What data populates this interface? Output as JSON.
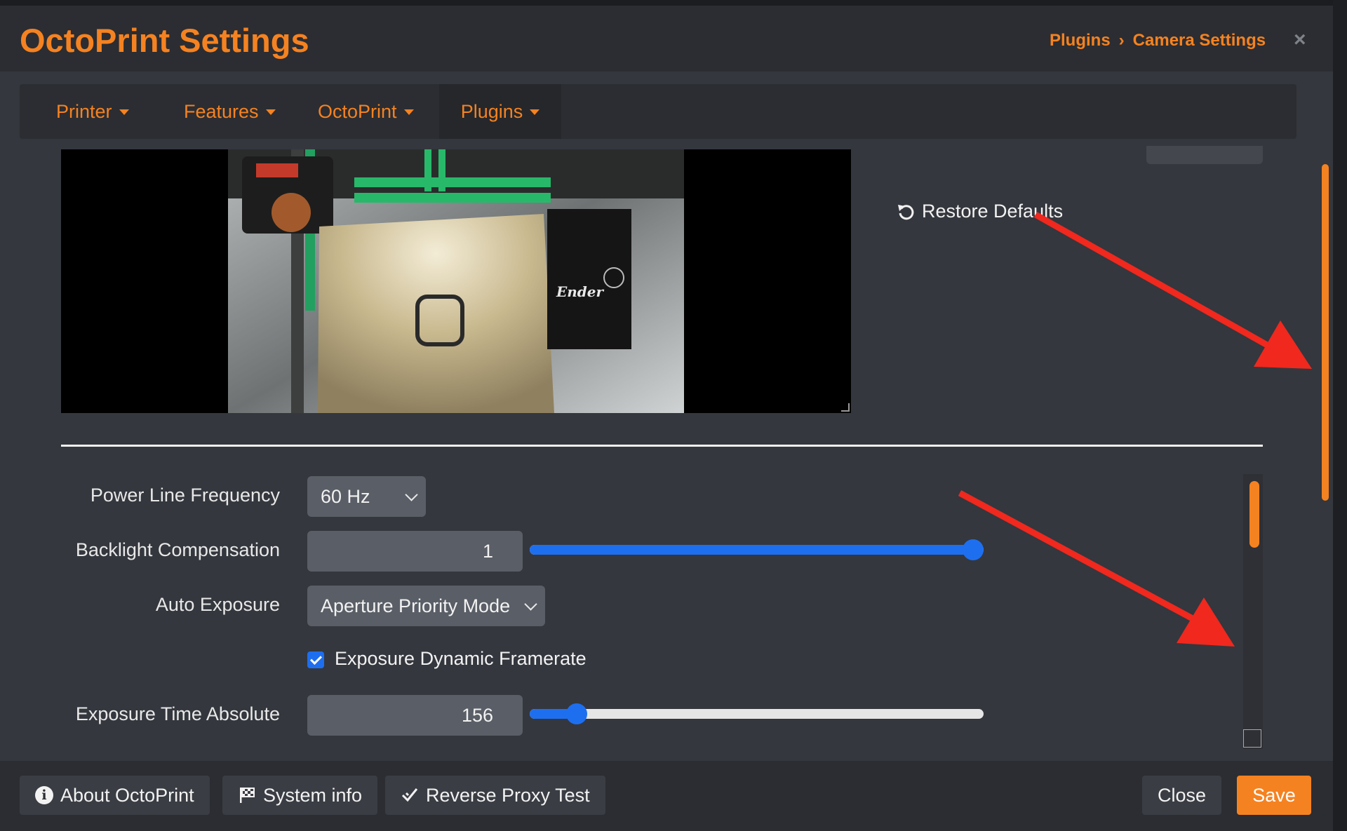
{
  "header": {
    "title": "OctoPrint Settings",
    "breadcrumb": [
      "Plugins",
      "Camera Settings"
    ],
    "close_glyph": "×"
  },
  "nav": {
    "tabs": [
      {
        "label": "Printer",
        "active": false
      },
      {
        "label": "Features",
        "active": false
      },
      {
        "label": "OctoPrint",
        "active": false
      },
      {
        "label": "Plugins",
        "active": true
      }
    ]
  },
  "camera": {
    "preview_alt": "webcam stream",
    "printer_brand_text": "Ender"
  },
  "restore_defaults_label": "Restore Defaults",
  "controls": {
    "power_line_frequency": {
      "label": "Power Line Frequency",
      "value": "60 Hz"
    },
    "backlight_compensation": {
      "label": "Backlight Compensation",
      "value": "1",
      "slider_fraction": 1.0
    },
    "auto_exposure": {
      "label": "Auto Exposure",
      "value": "Aperture Priority Mode"
    },
    "exposure_dynamic_framerate": {
      "label": "Exposure Dynamic Framerate",
      "checked": true
    },
    "exposure_time_absolute": {
      "label": "Exposure Time Absolute",
      "value": "156",
      "slider_fraction": 0.085
    }
  },
  "footer": {
    "about_label": "About OctoPrint",
    "system_info_label": "System info",
    "reverse_proxy_label": "Reverse Proxy Test",
    "close_label": "Close",
    "save_label": "Save"
  },
  "colors": {
    "accent": "#f58220",
    "slider": "#1e6ff0",
    "background": "#34373d",
    "annotation_arrow": "#f0281e"
  },
  "icons": [
    "info-icon",
    "flag-icon",
    "checkmark-icon",
    "restore-icon",
    "chevron-down-icon",
    "close-icon"
  ]
}
